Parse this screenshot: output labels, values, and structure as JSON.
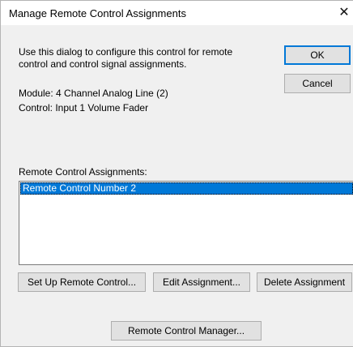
{
  "window": {
    "title": "Manage Remote Control Assignments",
    "close_glyph": "✕"
  },
  "description": "Use this dialog to configure this control for remote control and control signal assignments.",
  "module": "Module:  4 Channel Analog Line (2)",
  "control": "Control:  Input 1 Volume Fader",
  "buttons": {
    "ok": "OK",
    "cancel": "Cancel",
    "setup": "Set Up Remote Control...",
    "edit": "Edit Assignment...",
    "delete": "Delete Assignment",
    "manager": "Remote Control Manager..."
  },
  "assignments": {
    "label": "Remote Control Assignments:",
    "items": [
      "Remote Control Number 2"
    ],
    "selected_index": 0
  },
  "colors": {
    "accent": "#0078d7",
    "dialog_bg": "#f0f0f0",
    "button_bg": "#e1e1e1"
  }
}
